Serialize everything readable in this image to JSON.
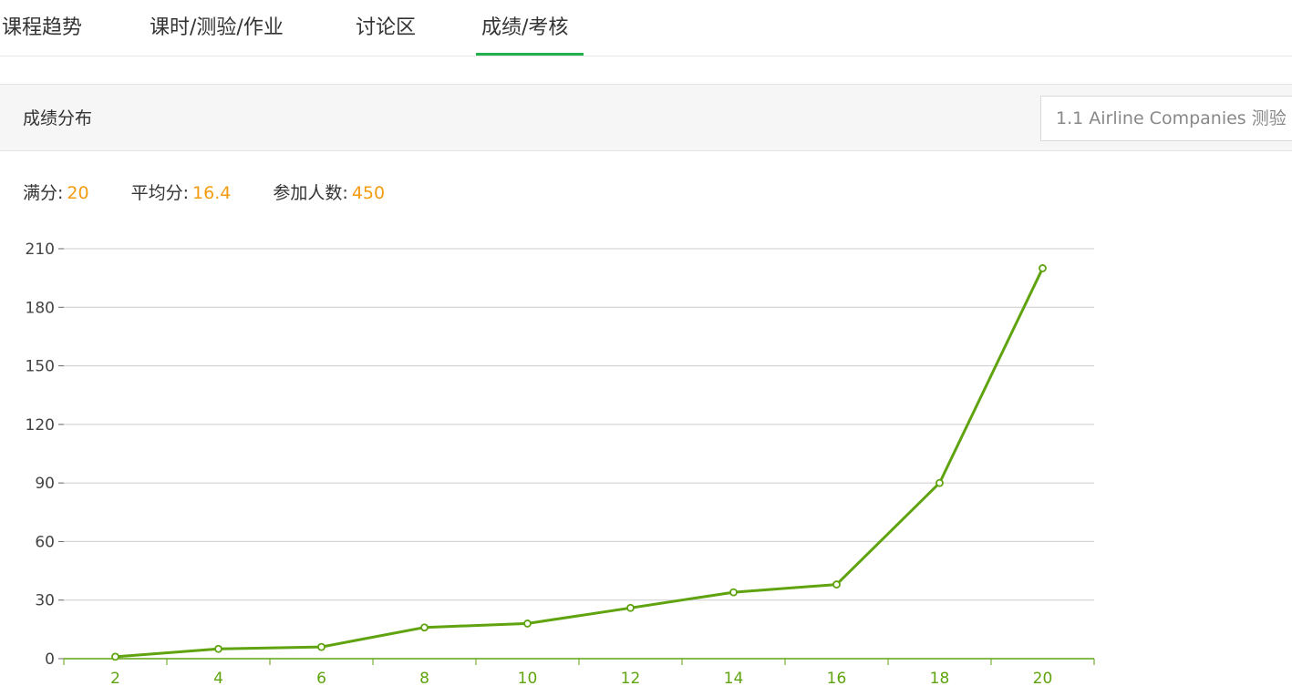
{
  "tabs": [
    {
      "label": "课程趋势"
    },
    {
      "label": "课时/测验/作业"
    },
    {
      "label": "讨论区"
    },
    {
      "label": "成绩/考核",
      "active": true
    }
  ],
  "section": {
    "title": "成绩分布",
    "quiz_selected": "1.1 Airline Companies 测验"
  },
  "stats": [
    {
      "label": "满分:",
      "value": "20"
    },
    {
      "label": "平均分:",
      "value": "16.4"
    },
    {
      "label": "参加人数:",
      "value": "450"
    }
  ],
  "colors": {
    "accent_tab": "#21b04b",
    "stat_value": "#f39c12",
    "series_line": "#5fa30f",
    "grid": "#cccccc",
    "axis": "#5fa30f"
  },
  "chart_data": {
    "type": "line",
    "x": [
      2,
      4,
      6,
      8,
      10,
      12,
      14,
      16,
      18,
      20
    ],
    "series": [
      {
        "values": [
          1,
          5,
          6,
          16,
          18,
          26,
          34,
          38,
          90,
          200
        ]
      }
    ],
    "y_ticks": [
      0,
      30,
      60,
      90,
      120,
      150,
      180,
      210
    ],
    "x_ticks": [
      2,
      4,
      6,
      8,
      10,
      12,
      14,
      16,
      18,
      20
    ],
    "ylim": [
      0,
      210
    ],
    "grid": true,
    "legend": "none"
  }
}
